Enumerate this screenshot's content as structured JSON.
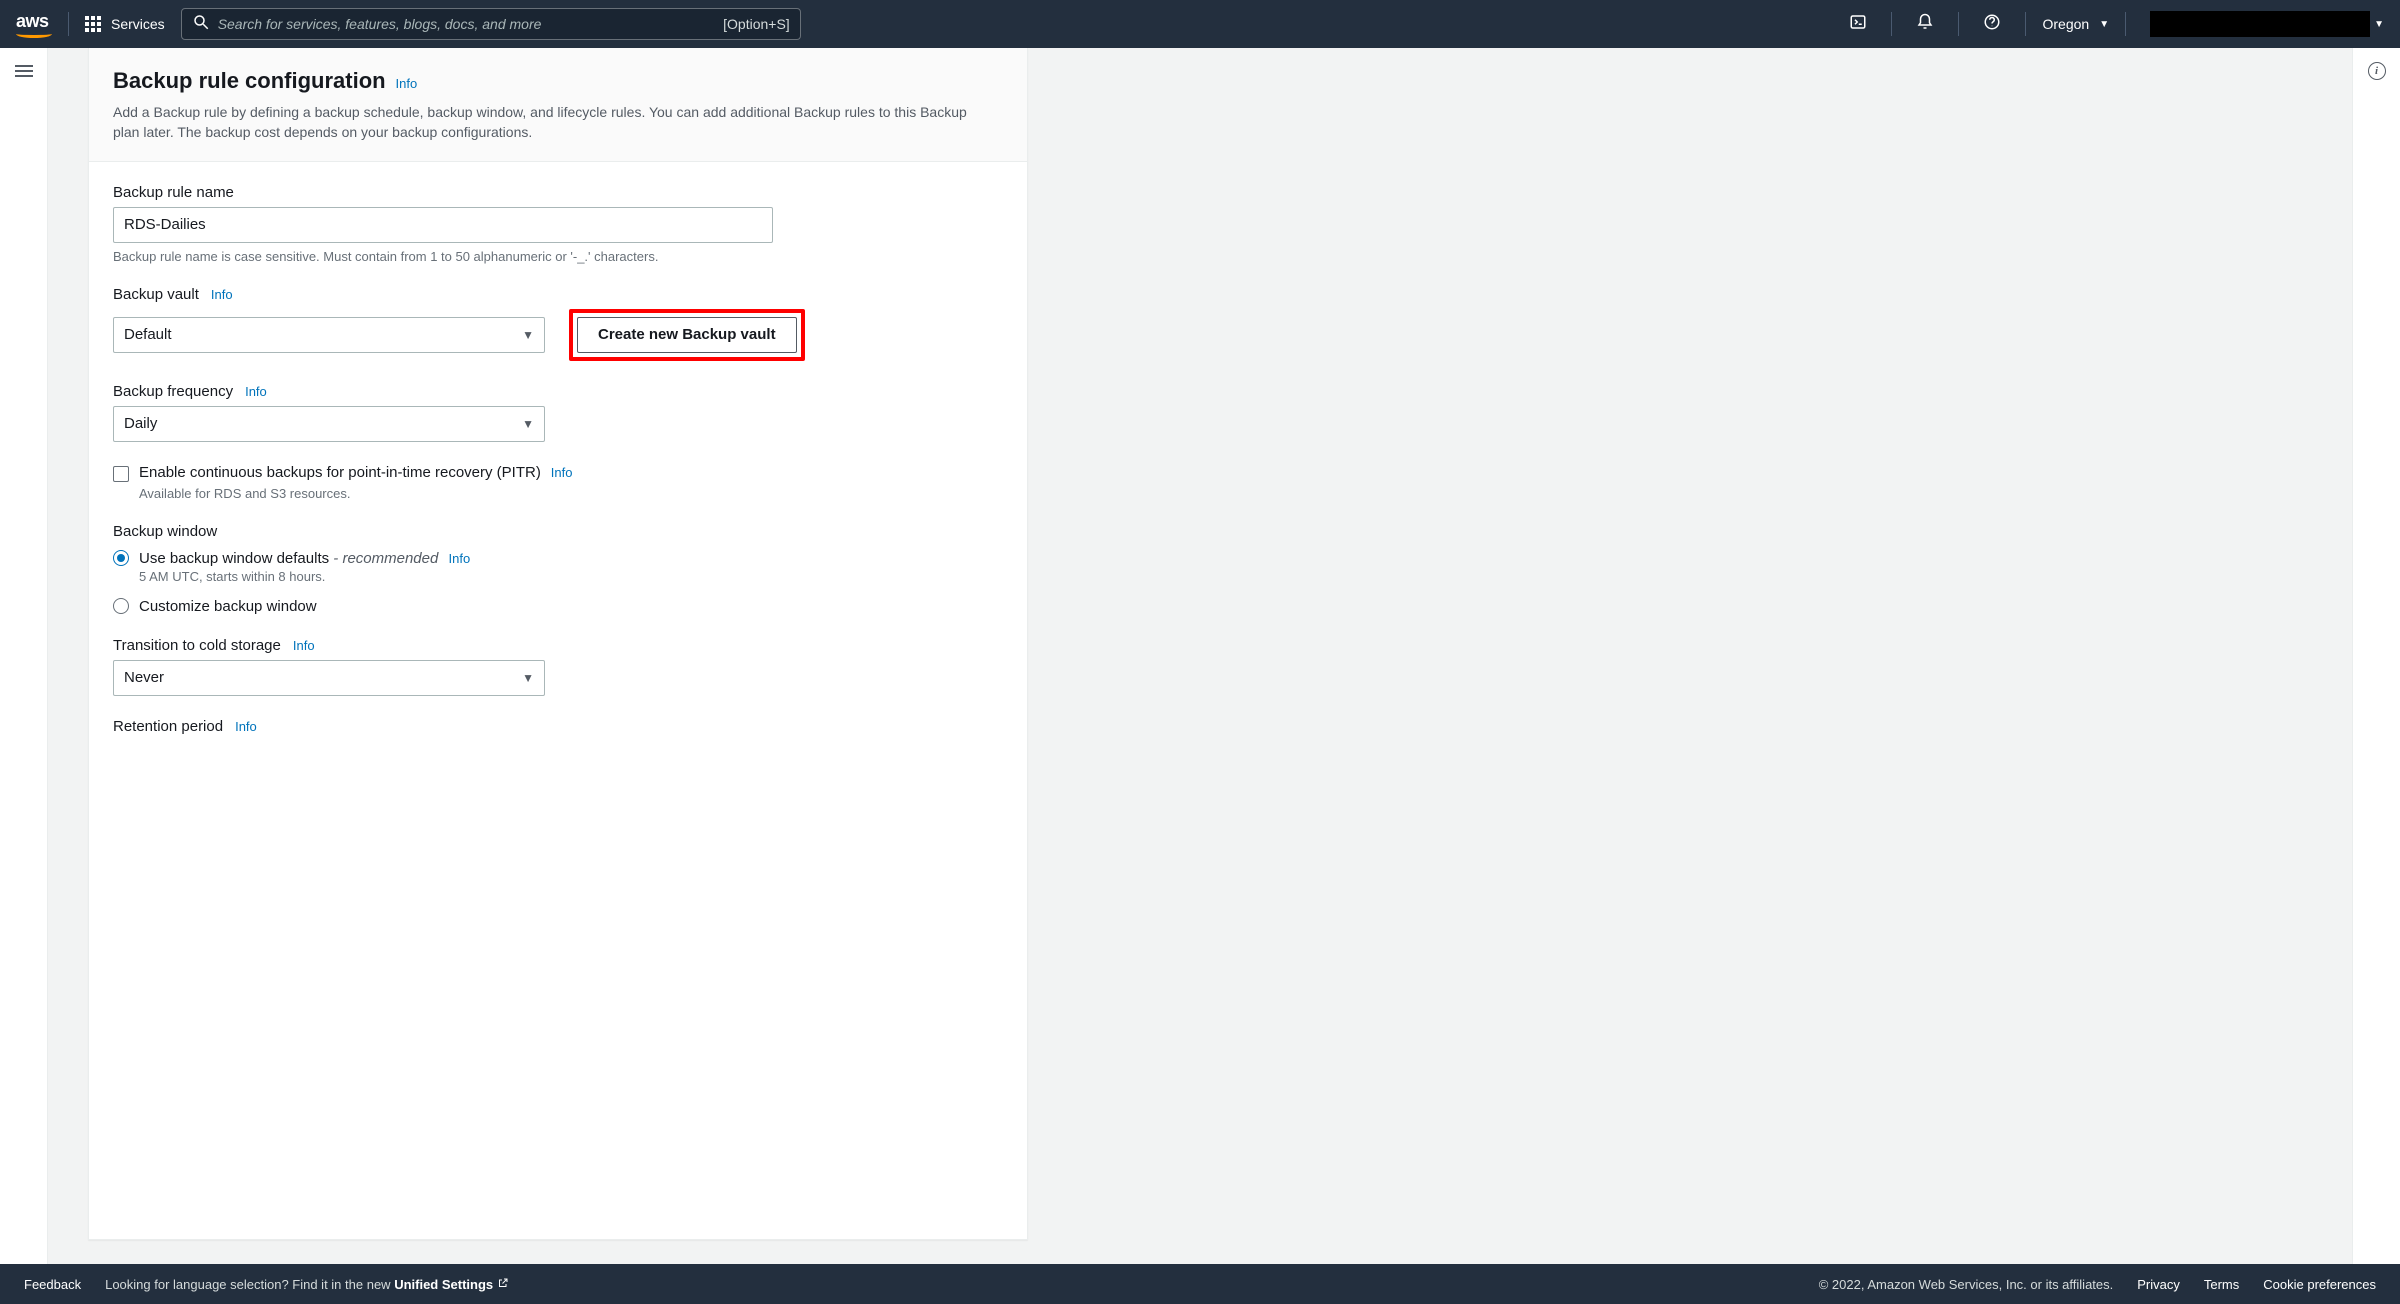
{
  "topnav": {
    "services_label": "Services",
    "search_placeholder": "Search for services, features, blogs, docs, and more",
    "search_shortcut": "[Option+S]",
    "region": "Oregon"
  },
  "panel": {
    "title": "Backup rule configuration",
    "info": "Info",
    "description": "Add a Backup rule by defining a backup schedule, backup window, and lifecycle rules. You can add additional Backup rules to this Backup plan later. The backup cost depends on your backup configurations."
  },
  "fields": {
    "rule_name": {
      "label": "Backup rule name",
      "value": "RDS-Dailies",
      "hint": "Backup rule name is case sensitive. Must contain from 1 to 50 alphanumeric or '-_.' characters."
    },
    "vault": {
      "label": "Backup vault",
      "info": "Info",
      "value": "Default",
      "create_button": "Create new Backup vault"
    },
    "frequency": {
      "label": "Backup frequency",
      "info": "Info",
      "value": "Daily"
    },
    "pitr": {
      "label": "Enable continuous backups for point-in-time recovery (PITR)",
      "info": "Info",
      "hint": "Available for RDS and S3 resources."
    },
    "window": {
      "label": "Backup window",
      "option_defaults": "Use backup window defaults",
      "option_defaults_rec": "- recommended",
      "option_defaults_info": "Info",
      "option_defaults_hint": "5 AM UTC, starts within 8 hours.",
      "option_customize": "Customize backup window"
    },
    "cold": {
      "label": "Transition to cold storage",
      "info": "Info",
      "value": "Never"
    },
    "retention": {
      "label": "Retention period",
      "info": "Info"
    }
  },
  "footer": {
    "feedback": "Feedback",
    "lang_prompt": "Looking for language selection? Find it in the new ",
    "unified": "Unified Settings",
    "copyright": "© 2022, Amazon Web Services, Inc. or its affiliates.",
    "privacy": "Privacy",
    "terms": "Terms",
    "cookies": "Cookie preferences"
  }
}
